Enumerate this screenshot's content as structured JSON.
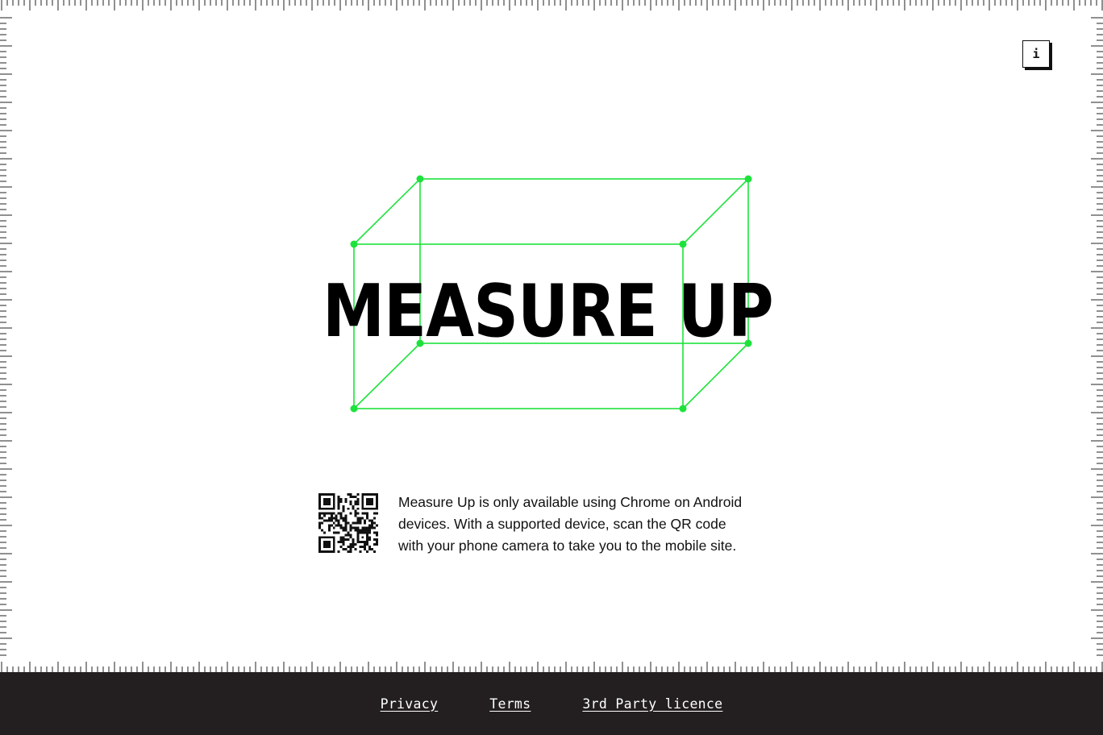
{
  "info_button": {
    "label": "i",
    "icon": "info-icon"
  },
  "title": "MEASURE UP",
  "message": "Measure Up is only available using Chrome on Android\ndevices. With a supported device, scan the QR code\nwith your phone camera to take you to the mobile site.",
  "qr_icon": "qr-code-icon",
  "footer": {
    "links": {
      "privacy": "Privacy",
      "terms": "Terms",
      "third_party": "3rd Party licence"
    }
  },
  "colors": {
    "accent": "#1ee23c",
    "footer_bg": "#231f20",
    "text": "#111111"
  }
}
